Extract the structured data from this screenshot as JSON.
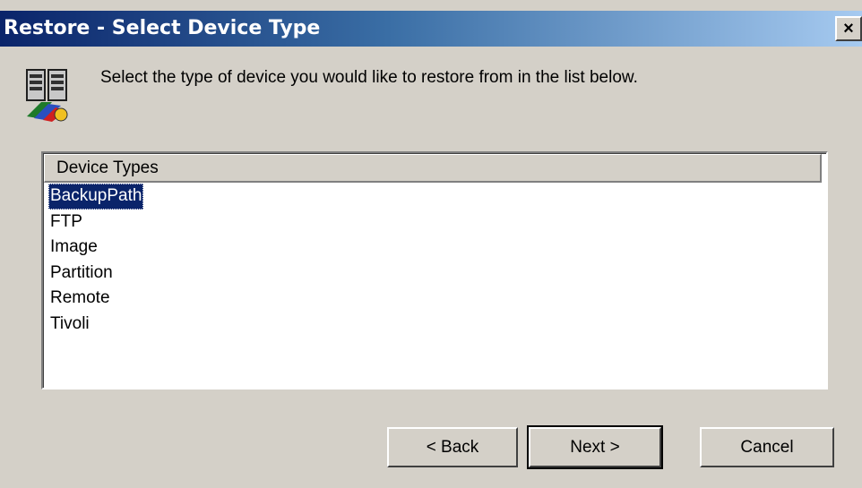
{
  "window": {
    "title": "Restore - Select Device Type",
    "close_label": "×"
  },
  "header": {
    "icon": "device-restore-icon",
    "instruction": "Select the type of device you would like to restore from in the list below."
  },
  "device_list": {
    "column_header": "Device Types",
    "items": [
      {
        "label": "BackupPath",
        "selected": true
      },
      {
        "label": "FTP",
        "selected": false
      },
      {
        "label": "Image",
        "selected": false
      },
      {
        "label": "Partition",
        "selected": false
      },
      {
        "label": "Remote",
        "selected": false
      },
      {
        "label": "Tivoli",
        "selected": false
      }
    ]
  },
  "buttons": {
    "back": "< Back",
    "next": "Next >",
    "cancel": "Cancel"
  },
  "colors": {
    "titlebar_start": "#0a246a",
    "titlebar_end": "#a6caf0",
    "selection": "#0a246a",
    "face": "#d4d0c8"
  }
}
